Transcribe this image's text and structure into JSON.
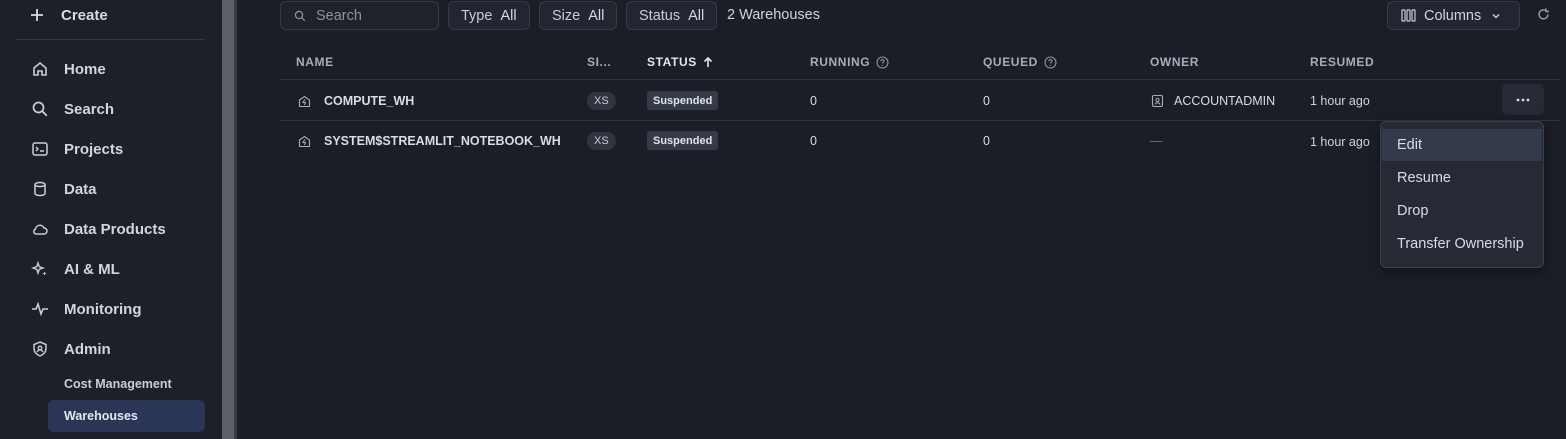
{
  "sidebar": {
    "create_label": "Create",
    "items": [
      {
        "label": "Home",
        "icon": "home-icon"
      },
      {
        "label": "Search",
        "icon": "search-icon"
      },
      {
        "label": "Projects",
        "icon": "projects-icon"
      },
      {
        "label": "Data",
        "icon": "database-icon"
      },
      {
        "label": "Data Products",
        "icon": "cloud-icon"
      },
      {
        "label": "AI & ML",
        "icon": "sparkle-icon"
      },
      {
        "label": "Monitoring",
        "icon": "pulse-icon"
      },
      {
        "label": "Admin",
        "icon": "shield-icon"
      }
    ],
    "sub_items": [
      {
        "label": "Cost Management",
        "active": false
      },
      {
        "label": "Warehouses",
        "active": true
      }
    ]
  },
  "toolbar": {
    "search_placeholder": "Search",
    "filters": [
      {
        "label": "Type",
        "value": "All"
      },
      {
        "label": "Size",
        "value": "All"
      },
      {
        "label": "Status",
        "value": "All"
      }
    ],
    "count_text": "2 Warehouses",
    "columns_label": "Columns"
  },
  "table": {
    "columns": [
      "NAME",
      "SI...",
      "STATUS",
      "RUNNING",
      "QUEUED",
      "OWNER",
      "RESUMED"
    ],
    "sorted_column": "STATUS",
    "rows": [
      {
        "name": "COMPUTE_WH",
        "size": "XS",
        "status": "Suspended",
        "running": "0",
        "queued": "0",
        "owner": "ACCOUNTADMIN",
        "resumed": "1 hour ago"
      },
      {
        "name": "SYSTEM$STREAMLIT_NOTEBOOK_WH",
        "size": "XS",
        "status": "Suspended",
        "running": "0",
        "queued": "0",
        "owner": "—",
        "resumed": "1 hour ago"
      }
    ]
  },
  "context_menu": {
    "items": [
      "Edit",
      "Resume",
      "Drop",
      "Transfer Ownership"
    ],
    "highlighted": "Edit"
  },
  "colors": {
    "background": "#1b1e27",
    "sidebar_active": "#2b3556",
    "badge": "#353a47"
  }
}
